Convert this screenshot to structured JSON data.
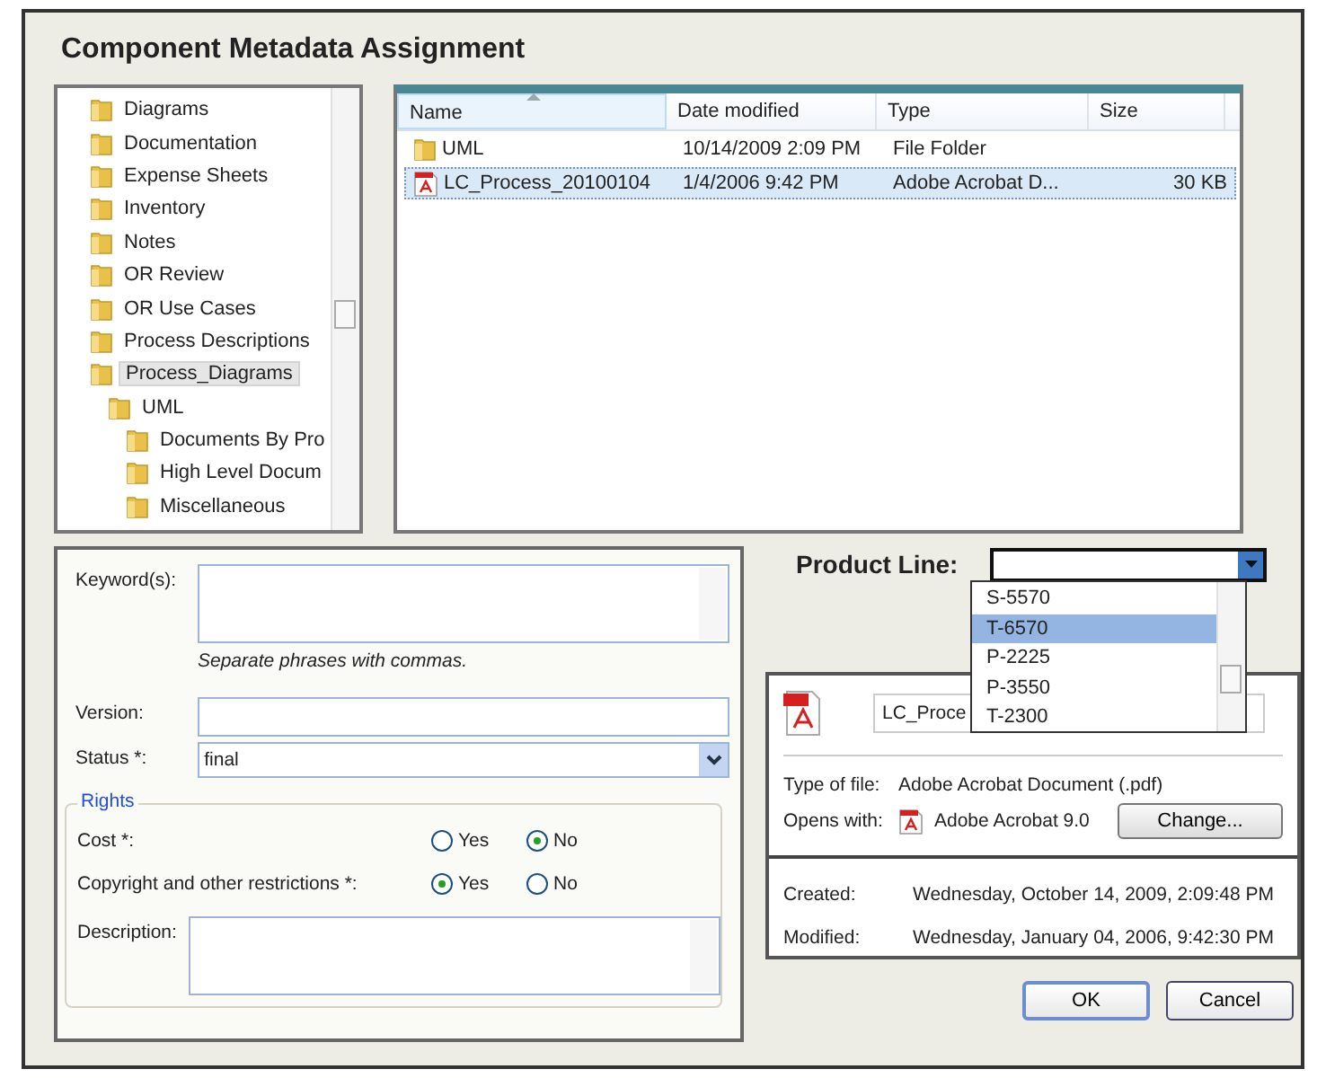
{
  "window": {
    "title": "Component Metadata Assignment"
  },
  "folder_tree": {
    "items": [
      {
        "label": "Diagrams",
        "selected": false
      },
      {
        "label": "Documentation",
        "selected": false
      },
      {
        "label": "Expense Sheets",
        "selected": false
      },
      {
        "label": "Inventory",
        "selected": false
      },
      {
        "label": "Notes",
        "selected": false
      },
      {
        "label": "OR Review",
        "selected": false
      },
      {
        "label": "OR Use Cases",
        "selected": false
      },
      {
        "label": "Process Descriptions",
        "selected": false
      },
      {
        "label": "Process_Diagrams",
        "selected": true,
        "children": [
          {
            "label": "UML",
            "selected": false,
            "children": [
              {
                "label": "Documents By Pro",
                "selected": false
              },
              {
                "label": "High Level Docum",
                "selected": false
              },
              {
                "label": "Miscellaneous",
                "selected": false
              }
            ]
          }
        ]
      }
    ]
  },
  "file_list": {
    "columns": [
      "Name",
      "Date modified",
      "Type",
      "Size"
    ],
    "rows": [
      {
        "kind": "folder",
        "name": "UML",
        "date_modified": "10/14/2009 2:09 PM",
        "type": "File Folder",
        "size": "",
        "selected": false
      },
      {
        "kind": "pdf",
        "name": "LC_Process_20100104",
        "date_modified": "1/4/2006 9:42 PM",
        "type": "Adobe Acrobat D...",
        "size": "30 KB",
        "selected": true
      }
    ]
  },
  "metadata_form": {
    "keywords": {
      "label": "Keyword(s):",
      "hint": "Separate phrases with commas."
    },
    "version": {
      "label": "Version:"
    },
    "status": {
      "label": "Status *:",
      "value": "final"
    },
    "rights": {
      "title": "Rights",
      "questions": [
        {
          "label": "Cost *:",
          "options": [
            {
              "label": "Yes",
              "selected": false
            },
            {
              "label": "No",
              "selected": true
            }
          ]
        },
        {
          "label": "Copyright and other restrictions *:",
          "options": [
            {
              "label": "Yes",
              "selected": true
            },
            {
              "label": "No",
              "selected": false
            }
          ]
        }
      ]
    },
    "description": {
      "label": "Description:"
    }
  },
  "product_line": {
    "label": "Product Line:",
    "options": [
      {
        "label": "S-5570",
        "selected": false
      },
      {
        "label": "T-6570",
        "selected": true
      },
      {
        "label": "P-2225",
        "selected": false
      },
      {
        "label": "P-3550",
        "selected": false
      },
      {
        "label": "T-2300",
        "selected": false
      }
    ]
  },
  "file_properties": {
    "file_name": "LC_Proce",
    "type_label": "Type of file:",
    "type_value": "Adobe Acrobat Document (.pdf)",
    "opens_label": "Opens with:",
    "opens_value": "Adobe Acrobat 9.0",
    "change_button": "Change...",
    "created_label": "Created:",
    "created_value": "Wednesday, October 14, 2009, 2:09:48 PM",
    "modified_label": "Modified:",
    "modified_value": "Wednesday, January 04, 2006, 9:42:30 PM"
  },
  "buttons": [
    "OK",
    "Cancel"
  ]
}
